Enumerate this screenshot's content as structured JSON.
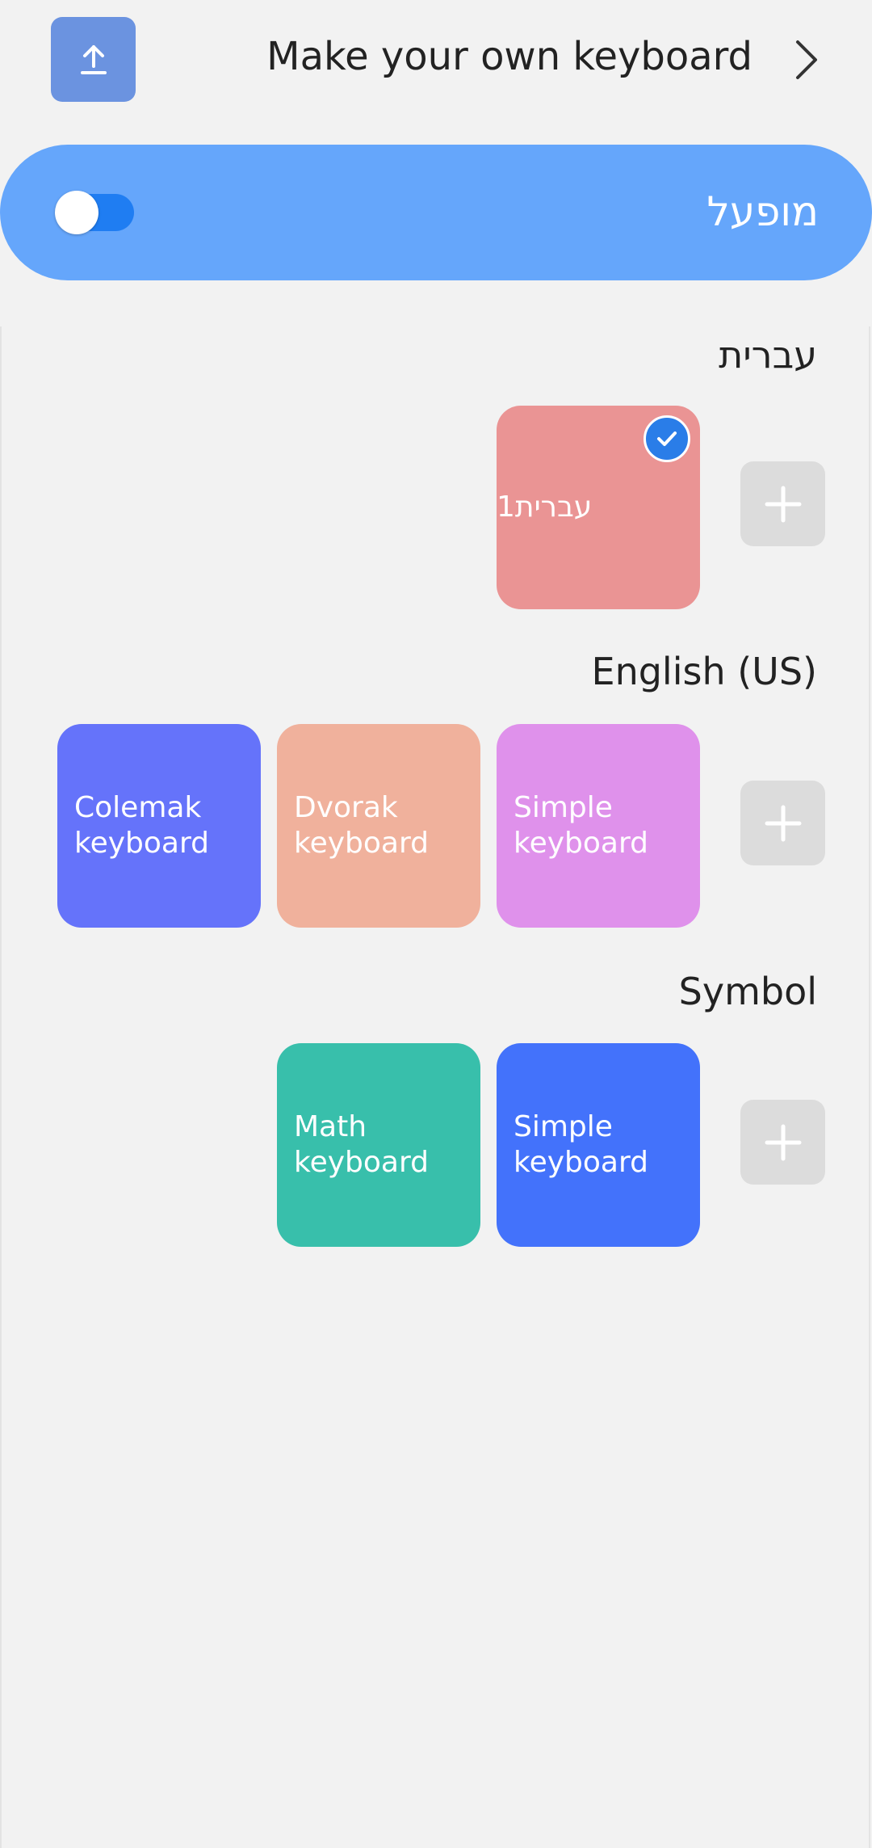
{
  "header": {
    "upload_icon": "upload-icon",
    "title": "Make your own keyboard",
    "chevron_icon": "chevron-right-icon"
  },
  "active_bar": {
    "label": "מופעל",
    "toggle_on": true
  },
  "sections": [
    {
      "title": "עברית",
      "keyboards": [
        {
          "label": "עברית1",
          "color": "#ea9494",
          "selected": true
        }
      ]
    },
    {
      "title": "English (US)",
      "keyboards": [
        {
          "label": "Colemak keyboard",
          "color": "#6573fa"
        },
        {
          "label": "Dvorak keyboard",
          "color": "#f0b19c"
        },
        {
          "label": "Simple keyboard",
          "color": "#df91eb"
        }
      ]
    },
    {
      "title": "Symbol",
      "keyboards": [
        {
          "label": "Math keyboard",
          "color": "#38bfab"
        },
        {
          "label": "Simple keyboard",
          "color": "#4372fb"
        }
      ]
    }
  ],
  "colors": {
    "accent": "#65a6fb",
    "toggle": "#1f7df2",
    "add_button": "#dcdcdc"
  }
}
